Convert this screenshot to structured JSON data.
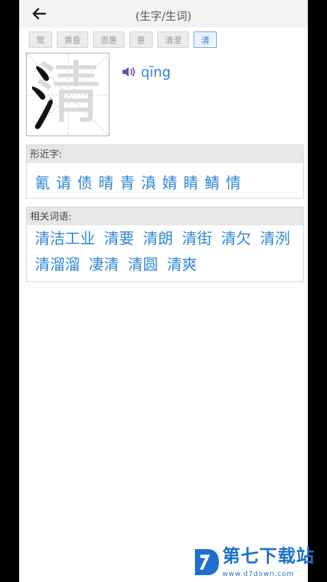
{
  "header": {
    "title": "(生字/生词)",
    "back_icon": "arrow-left-icon"
  },
  "tabs": [
    {
      "label": "鹭",
      "active": false
    },
    {
      "label": "黄昏",
      "active": false
    },
    {
      "label": "恩惠",
      "active": false
    },
    {
      "label": "惠",
      "active": false
    },
    {
      "label": "清澄",
      "active": false
    },
    {
      "label": "清",
      "active": true
    }
  ],
  "character": {
    "glyph": "清",
    "pinyin": "qīng",
    "sound_icon": "speaker-icon"
  },
  "similar": {
    "heading": "形近字:",
    "items": [
      "氰",
      "请",
      "债",
      "晴",
      "青",
      "滇",
      "婧",
      "睛",
      "鲭",
      "情"
    ]
  },
  "related": {
    "heading": "相关词语:",
    "items": [
      "清洁工业",
      "清要",
      "清朗",
      "清街",
      "清欠",
      "清洌",
      "清溜溜",
      "凄清",
      "清圆",
      "清爽"
    ]
  },
  "watermark": {
    "title": "第七下载站",
    "url": "www.d7down.com"
  },
  "colors": {
    "accent": "#2f86d5",
    "header_bg": "#f2f2f2",
    "section_head_bg": "#e6e6e6"
  }
}
